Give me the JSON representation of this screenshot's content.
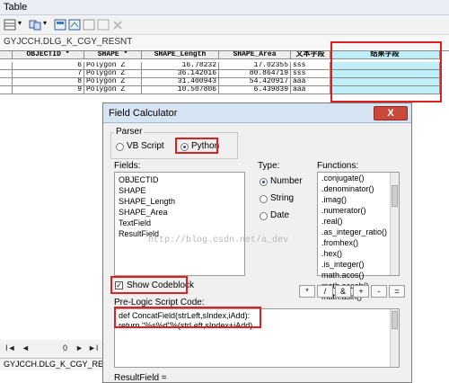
{
  "window_title": "Table",
  "table_name": "GYJCCH.DLG_K_CGY_RESNT",
  "table_name_bottom": "GYJCCH.DLG_K_CGY_RESNT",
  "columns": [
    "OBJECTID *",
    "SHAPE *",
    "SHAPE_Length",
    "SHAPE_Area",
    "文本字段",
    "结果字段"
  ],
  "rows": [
    [
      "6",
      "Polygon Z",
      "16.78232",
      "17.02355",
      "sss",
      ""
    ],
    [
      "7",
      "Polygon Z",
      "36.142016",
      "80.864719",
      "sss",
      ""
    ],
    [
      "8",
      "Polygon Z",
      "31.400943",
      "54.420917",
      "aaa",
      ""
    ],
    [
      "9",
      "Polygon Z",
      "10.507806",
      "6.439839",
      "aaa",
      ""
    ]
  ],
  "nav": {
    "first": "I◄",
    "prev": "◄",
    "record": "0",
    "next": "►",
    "last": "►I"
  },
  "dialog": {
    "title": "Field Calculator",
    "close": "X",
    "parser_label": "Parser",
    "parser_options": [
      "VB Script",
      "Python"
    ],
    "parser_selected": "Python",
    "fields_label": "Fields:",
    "fields": [
      "OBJECTID",
      "SHAPE",
      "SHAPE_Length",
      "SHAPE_Area",
      "TextField",
      "ResultField"
    ],
    "type_label": "Type:",
    "types": [
      "Number",
      "String",
      "Date"
    ],
    "type_selected": "Number",
    "functions_label": "Functions:",
    "functions": [
      ".conjugate()",
      ".denominator()",
      ".imag()",
      ".numerator()",
      ".real()",
      ".as_integer_ratio()",
      ".fromhex()",
      ".hex()",
      ".is_integer()",
      "math.acos()",
      "math.acosh()",
      "math.asin()"
    ],
    "show_codeblock_label": "Show Codeblock",
    "show_codeblock_checked": true,
    "operators": [
      "*",
      "/",
      "&",
      "+",
      "-",
      "="
    ],
    "prelogic_label": "Pre-Logic Script Code:",
    "code_lines": [
      "def ConcatField(strLeft,sIndex,iAdd):",
      "  return \"%s%d\"%(strLeft,sIndex+iAdd)"
    ],
    "result_label": "ResultField ="
  },
  "watermark": "http://blog.csdn.net/a_dev",
  "colors": {
    "highlight": "#e02020",
    "selected_column": "#bff0f7"
  }
}
